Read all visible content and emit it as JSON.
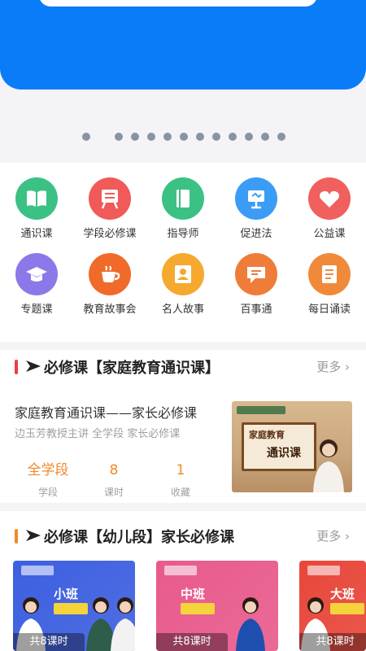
{
  "carousel": {
    "dot_count": 12,
    "active_index": 0
  },
  "grid": [
    {
      "label": "通识课",
      "icon": "book-icon",
      "color": "#3cc184"
    },
    {
      "label": "学段必修课",
      "icon": "lectern-icon",
      "color": "#f05a58"
    },
    {
      "label": "指导师",
      "icon": "notebook-icon",
      "color": "#3cc184"
    },
    {
      "label": "促进法",
      "icon": "easel-icon",
      "color": "#3b9cf5"
    },
    {
      "label": "公益课",
      "icon": "heart-icon",
      "color": "#f0605e"
    },
    {
      "label": "专题课",
      "icon": "graduation-cap-icon",
      "color": "#8c78e8"
    },
    {
      "label": "教育故事会",
      "icon": "coffee-cup-icon",
      "color": "#f06a2a"
    },
    {
      "label": "名人故事",
      "icon": "portrait-book-icon",
      "color": "#f5a92e"
    },
    {
      "label": "百事通",
      "icon": "chat-bubble-icon",
      "color": "#f07c3a"
    },
    {
      "label": "每日诵读",
      "icon": "document-icon",
      "color": "#f08a3a"
    }
  ],
  "section1": {
    "title": "必修课【家庭教育通识课】",
    "more": "更多",
    "accent": "#e8413c",
    "course": {
      "title": "家庭教育通识课——家长必修课",
      "subtitle": "边玉芳教授主讲 全学段 家长必修课",
      "thumb_title_1": "家庭教育",
      "thumb_title_2": "通识课",
      "stats": [
        {
          "value": "全学段",
          "label": "学段"
        },
        {
          "value": "8",
          "label": "课时"
        },
        {
          "value": "1",
          "label": "收藏"
        }
      ]
    }
  },
  "section2": {
    "title": "必修课【幼儿段】家长必修课",
    "more": "更多",
    "accent": "#f08a2a",
    "cards": [
      {
        "label": "小班",
        "tag": "共8课时",
        "bg": "#3d5fe0"
      },
      {
        "label": "中班",
        "tag": "共8课时",
        "bg": "#e85a8c"
      },
      {
        "label": "大班",
        "tag": "共8课时",
        "bg": "#e8463a"
      }
    ]
  }
}
